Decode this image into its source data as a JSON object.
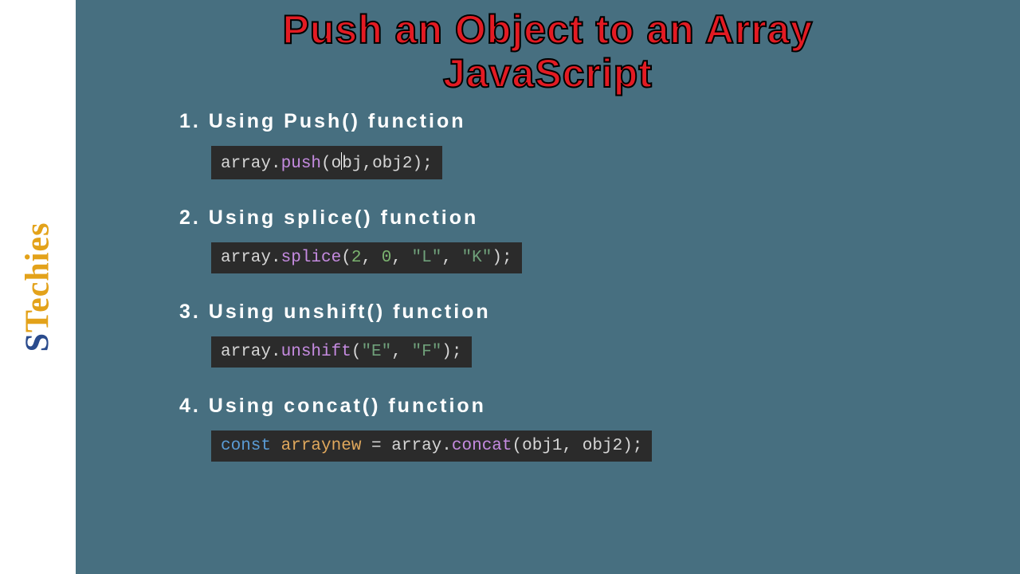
{
  "logo": {
    "part1": "S",
    "part2": "T",
    "part3": "echies"
  },
  "title_line1": "Push an Object to an Array",
  "title_line2": "JavaScript",
  "sections": [
    {
      "heading": "1. Using Push() function"
    },
    {
      "heading": "2. Using splice() function"
    },
    {
      "heading": "3. Using unshift() function"
    },
    {
      "heading": "4. Using concat() function"
    }
  ],
  "code": {
    "s1": {
      "obj": "array",
      "dot": ".",
      "method": "push",
      "open": "(",
      "arg_pre": "o",
      "arg_post": "bj,obj2",
      "close": ");"
    },
    "s2": {
      "obj": "array",
      "dot": ".",
      "method": "splice",
      "open": "(",
      "n1": "2",
      "comma1": ", ",
      "n2": "0",
      "comma2": ", ",
      "str1": "\"L\"",
      "comma3": ", ",
      "str2": "\"K\"",
      "close": ");"
    },
    "s3": {
      "obj": "array",
      "dot": ".",
      "method": "unshift",
      "open": "(",
      "str1": "\"E\"",
      "comma1": ", ",
      "str2": "\"F\"",
      "close": ");"
    },
    "s4": {
      "kw": "const",
      "sp1": " ",
      "varname": "arraynew",
      "eq": " = ",
      "obj": "array",
      "dot": ".",
      "method": "concat",
      "open": "(",
      "arg1": "obj1",
      "comma1": ", ",
      "arg2": "obj2",
      "close": ");"
    }
  }
}
